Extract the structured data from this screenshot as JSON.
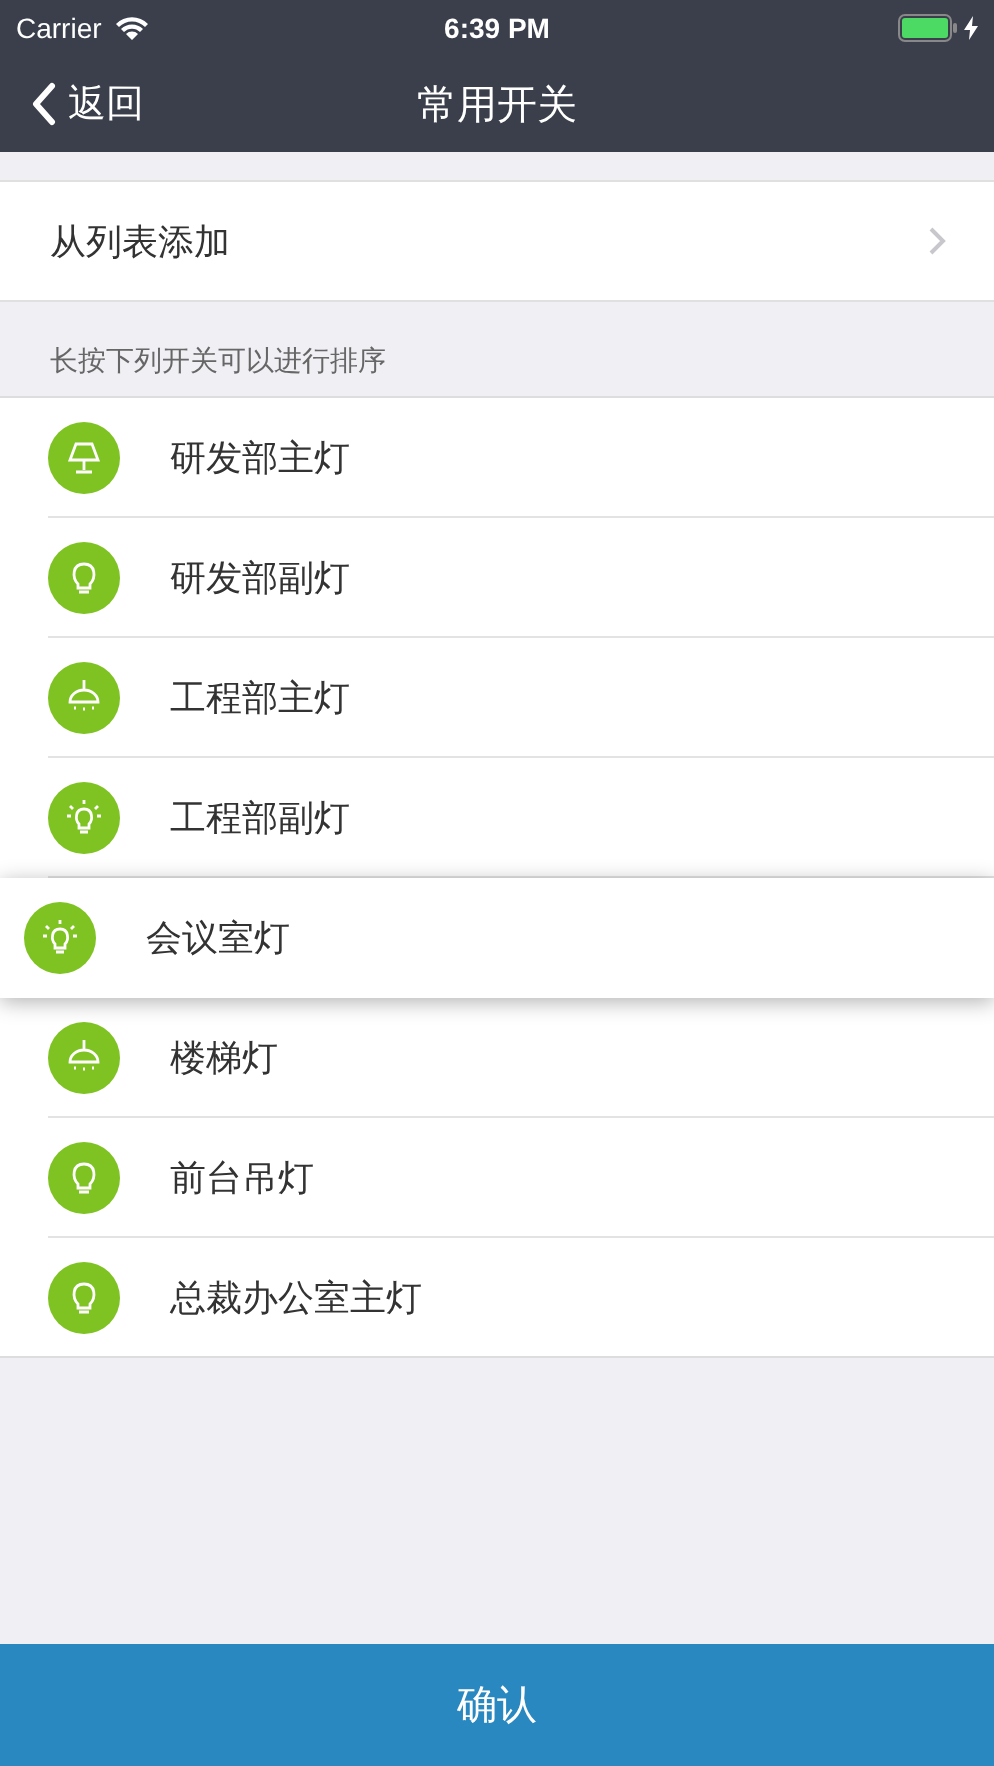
{
  "status_bar": {
    "carrier": "Carrier",
    "time": "6:39 PM",
    "charging": true
  },
  "nav": {
    "back": "返回",
    "title": "常用开关"
  },
  "add_row": {
    "label": "从列表添加"
  },
  "section_header": "长按下列开关可以进行排序",
  "switches": [
    {
      "name": "研发部主灯",
      "kind": "lamp",
      "dragging": false
    },
    {
      "name": "研发部副灯",
      "kind": "bulb",
      "dragging": false
    },
    {
      "name": "工程部主灯",
      "kind": "pendant",
      "dragging": false
    },
    {
      "name": "工程部副灯",
      "kind": "glow",
      "dragging": false
    },
    {
      "name": "会议室灯",
      "kind": "glow",
      "dragging": true
    },
    {
      "name": "楼梯灯",
      "kind": "pendant",
      "dragging": false
    },
    {
      "name": "前台吊灯",
      "kind": "bulb",
      "dragging": false
    },
    {
      "name": "总裁办公室主灯",
      "kind": "bulb",
      "dragging": false
    }
  ],
  "confirm_button": "确认"
}
